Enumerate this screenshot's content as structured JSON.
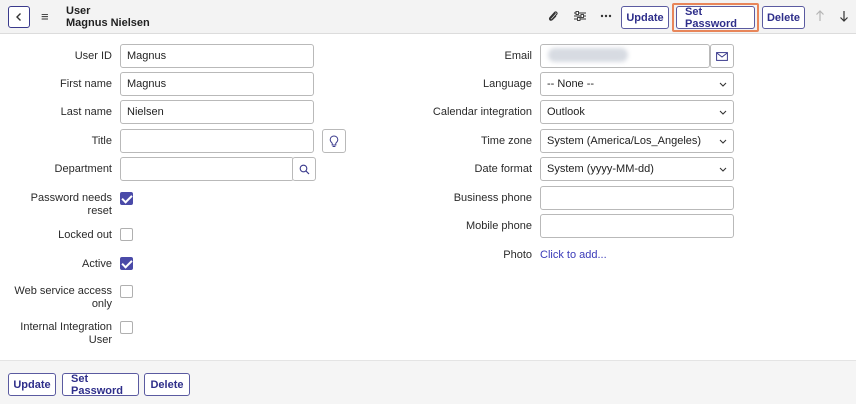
{
  "header": {
    "table_name": "User",
    "record_name": "Magnus Nielsen",
    "buttons": {
      "update": "Update",
      "set_password": "Set Password",
      "delete": "Delete"
    },
    "icons": [
      "back-icon",
      "hamburger-icon",
      "paperclip-icon",
      "settings-sliders-icon",
      "more-icon",
      "arrow-up-icon",
      "arrow-down-icon"
    ]
  },
  "form": {
    "left": {
      "user_id": {
        "label": "User ID",
        "value": "Magnus"
      },
      "first_name": {
        "label": "First name",
        "value": "Magnus"
      },
      "last_name": {
        "label": "Last name",
        "value": "Nielsen"
      },
      "title": {
        "label": "Title",
        "value": ""
      },
      "department": {
        "label": "Department",
        "value": ""
      },
      "password_needs_reset": {
        "label_line1": "Password needs",
        "label_line2": "reset",
        "checked": true
      },
      "locked_out": {
        "label": "Locked out",
        "checked": false
      },
      "active": {
        "label": "Active",
        "checked": true
      },
      "web_service_access_only": {
        "label_line1": "Web service access",
        "label_line2": "only",
        "checked": false
      },
      "internal_integration_user": {
        "label_line1": "Internal Integration",
        "label_line2": "User",
        "checked": false
      }
    },
    "right": {
      "email": {
        "label": "Email"
      },
      "language": {
        "label": "Language",
        "value": "-- None --"
      },
      "calendar_integration": {
        "label": "Calendar integration",
        "value": "Outlook"
      },
      "time_zone": {
        "label": "Time zone",
        "value": "System (America/Los_Angeles)"
      },
      "date_format": {
        "label": "Date format",
        "value": "System (yyyy-MM-dd)"
      },
      "business_phone": {
        "label": "Business phone",
        "value": ""
      },
      "mobile_phone": {
        "label": "Mobile phone",
        "value": ""
      },
      "photo": {
        "label": "Photo",
        "link": "Click to add..."
      }
    }
  },
  "footer": {
    "update": "Update",
    "set_password": "Set Password",
    "delete": "Delete"
  },
  "colors": {
    "accent": "#2e2e8a",
    "highlight": "#e8865a",
    "checkbox_checked": "#4a4aa8"
  }
}
